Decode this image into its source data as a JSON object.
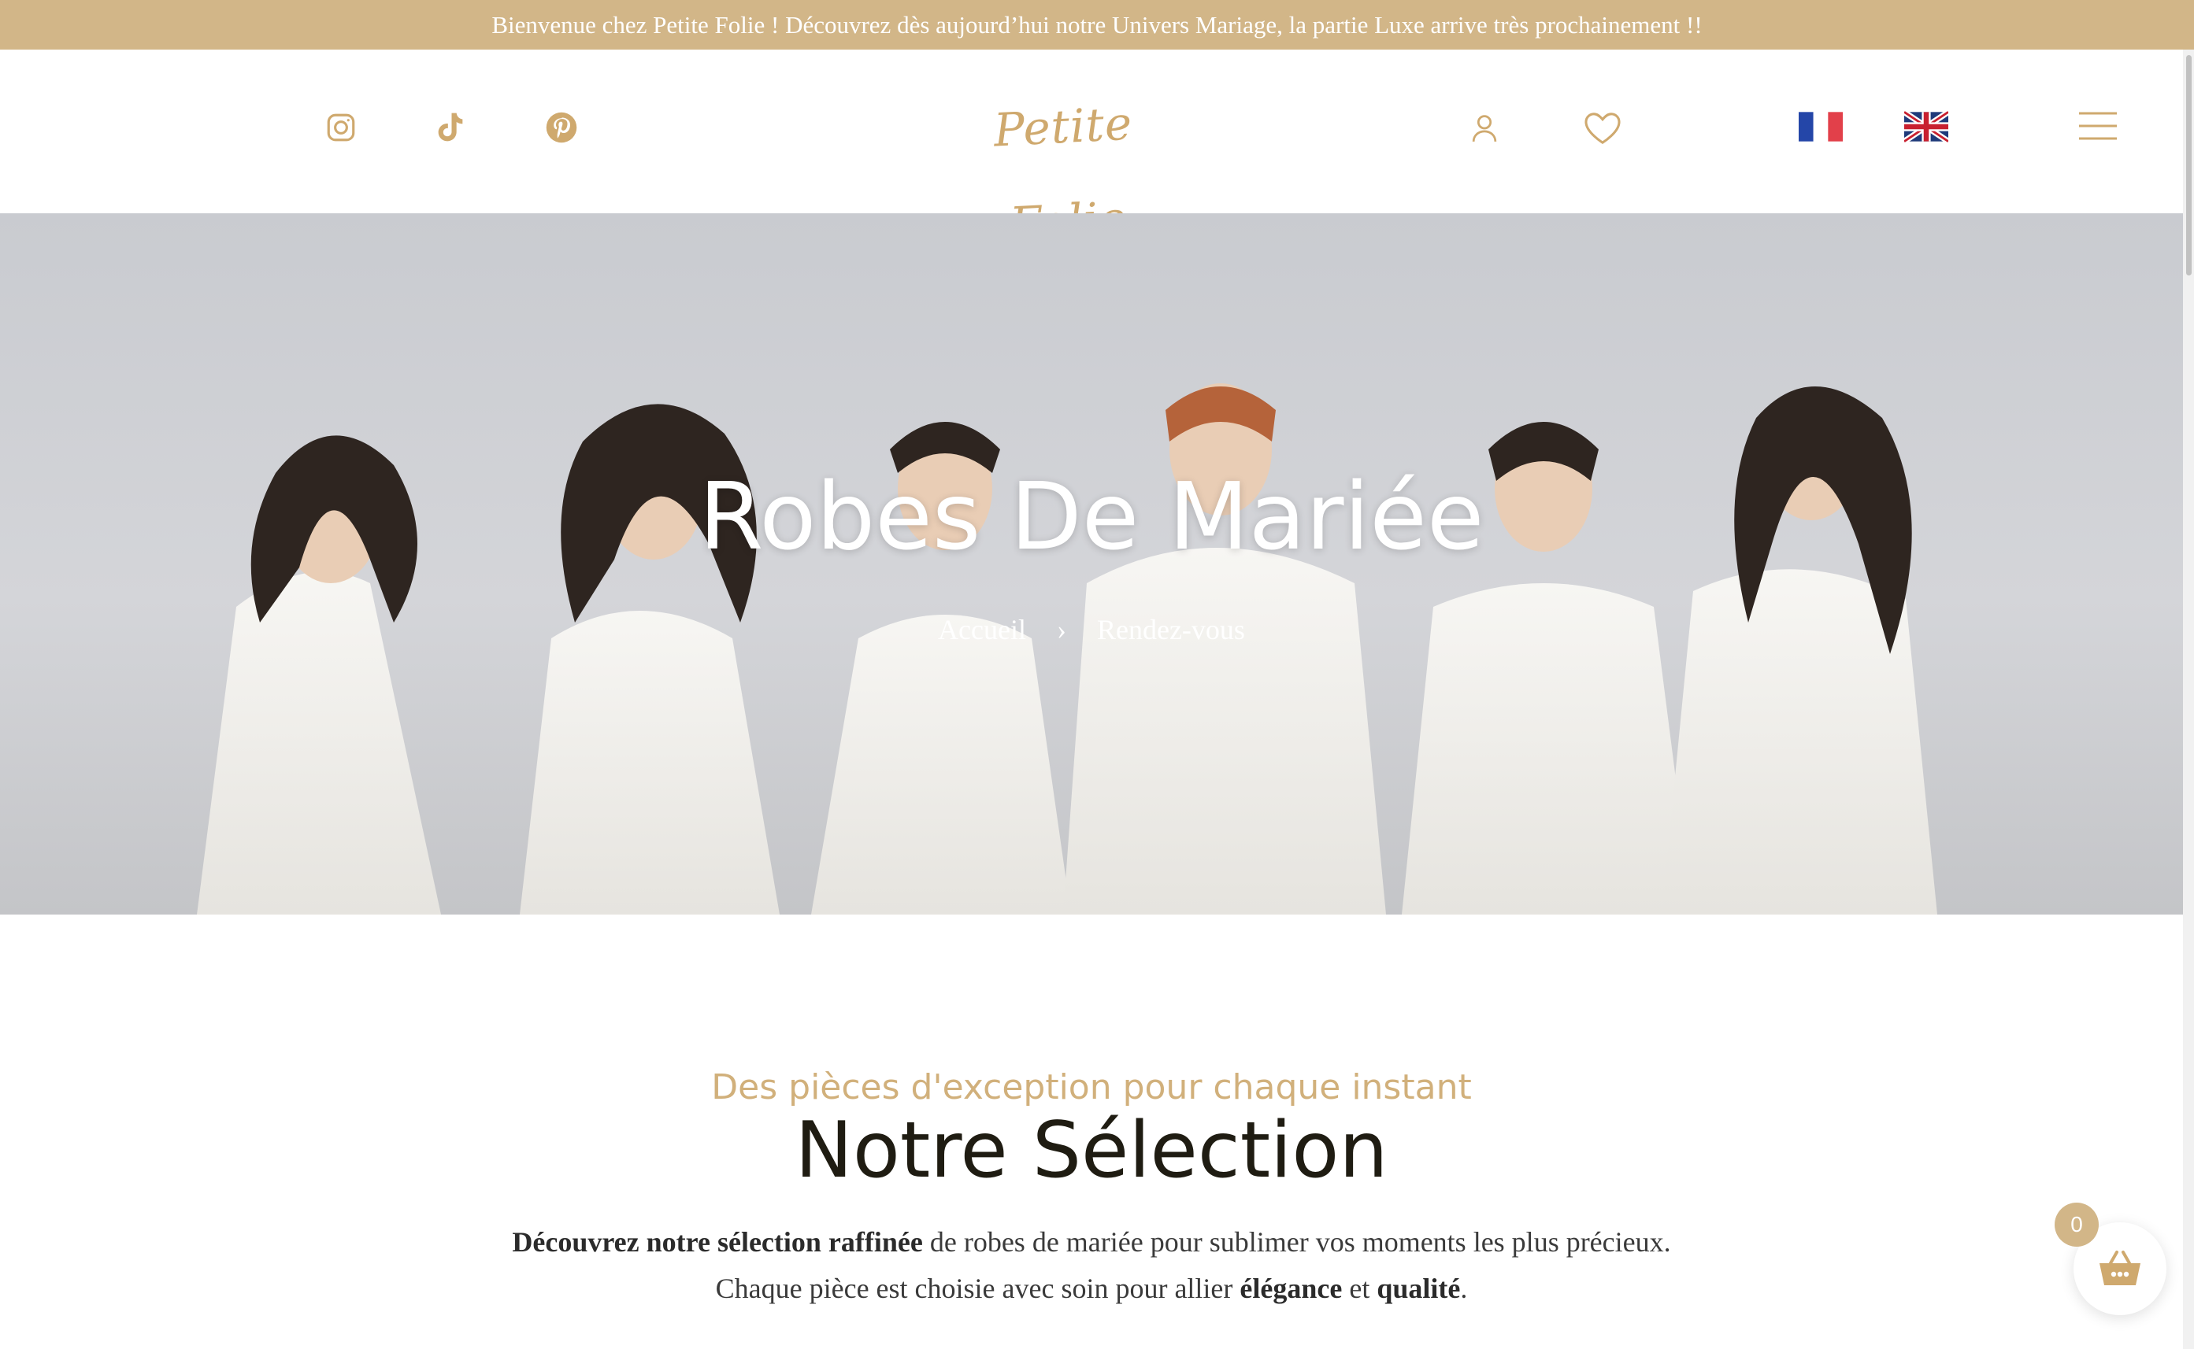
{
  "announcement": "Bienvenue chez Petite Folie ! Découvrez dès aujourd’hui notre Univers Mariage, la partie Luxe arrive très prochainement !!",
  "header": {
    "logo_text": "Petite Folie",
    "social_icons": [
      "instagram-icon",
      "tiktok-icon",
      "pinterest-icon"
    ],
    "account_icon": "user-icon",
    "wishlist_icon": "heart-icon",
    "languages": [
      "fr-flag",
      "en-flag"
    ],
    "menu_icon": "hamburger-menu-icon"
  },
  "hero": {
    "title": "Robes De Mariée",
    "breadcrumb": {
      "home": "Accueil",
      "separator": "›",
      "current": "Rendez-vous"
    }
  },
  "section": {
    "subtitle": "Des pièces d'exception pour chaque instant",
    "title": "Notre Sélection",
    "line1": {
      "bold": "Découvrez notre sélection raffinée",
      "rest": " de robes de mariée pour sublimer vos moments les plus précieux."
    },
    "line2": {
      "pre": "Chaque pièce est choisie avec soin pour allier ",
      "bold1": "élégance",
      "mid": " et ",
      "bold2": "qualité",
      "post": "."
    }
  },
  "cart": {
    "count": "0",
    "icon": "basket-icon"
  },
  "colors": {
    "accent": "#d2b688",
    "gold_text": "#cfa96e",
    "dark_text": "#1f1c12"
  }
}
